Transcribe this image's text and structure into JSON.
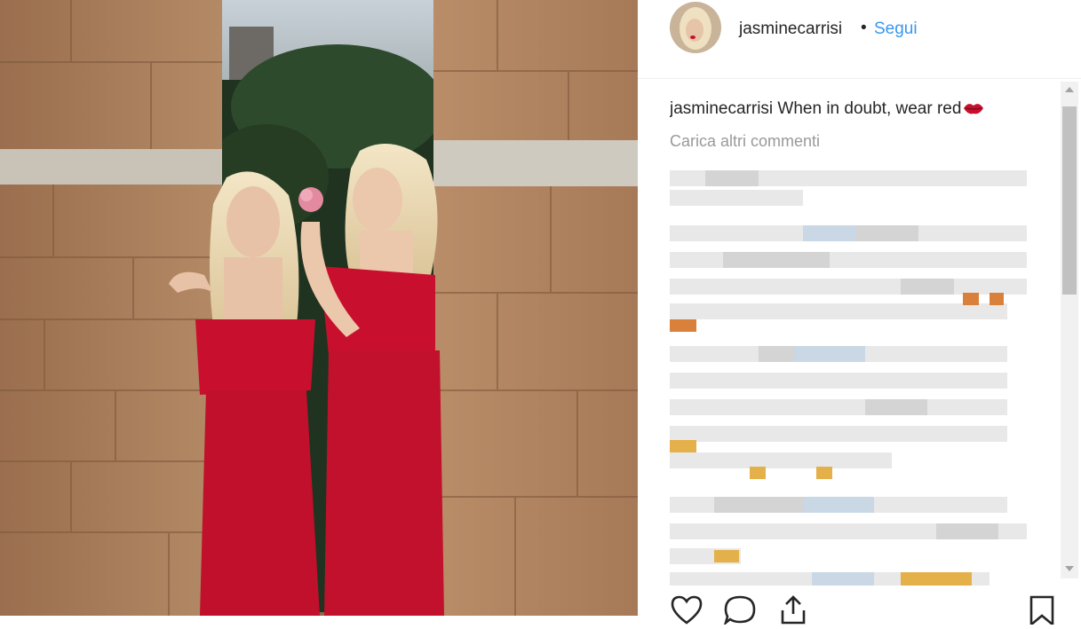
{
  "post": {
    "username": "jasminecarrisi",
    "separator": "•",
    "follow_label": "Segui"
  },
  "caption": {
    "username": "jasminecarrisi",
    "text": "When in doubt, wear red"
  },
  "comments": {
    "load_more_label": "Carica altri commenti"
  },
  "icons": {
    "like": "heart-icon",
    "comment": "comment-icon",
    "share": "share-icon",
    "save": "bookmark-icon",
    "caption_emoji": "lips-icon"
  },
  "colors": {
    "link": "#3897f0",
    "text": "#262626",
    "muted": "#999999",
    "dress_red": "#c8102e"
  }
}
